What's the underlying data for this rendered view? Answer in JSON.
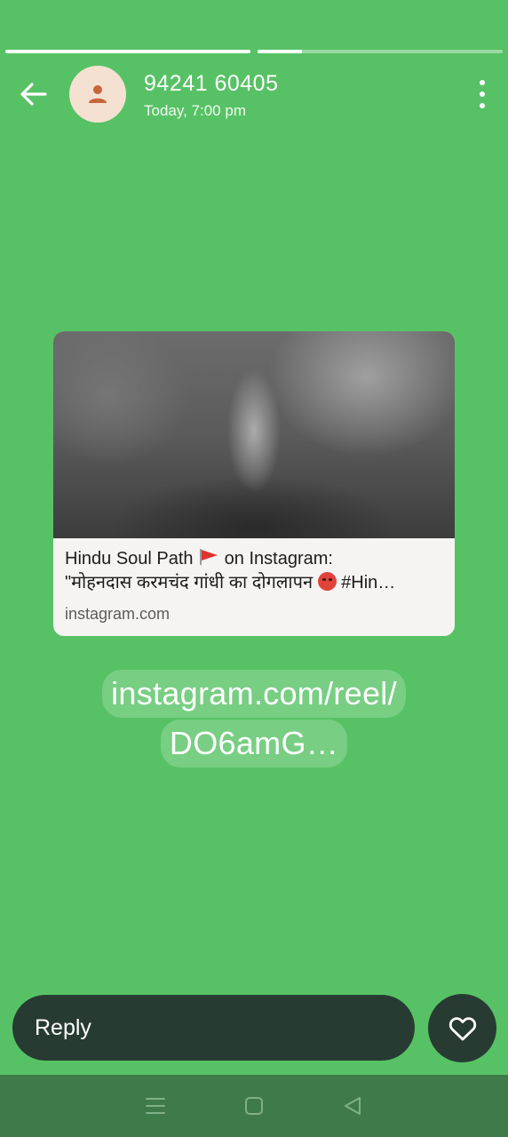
{
  "status": {
    "progress": [
      1.0,
      0.18
    ]
  },
  "header": {
    "contact_name": "94241 60405",
    "timestamp": "Today, 7:00 pm",
    "back_icon": "arrow-left-icon",
    "avatar_icon": "person-icon",
    "menu_icon": "more-vertical-icon"
  },
  "preview": {
    "title_line1_a": "Hindu Soul Path",
    "title_line1_b": "on Instagram:",
    "title_line2_a": "\"मोहनदास करमचंद गांधी का दोगलापन",
    "title_line2_b": "#Hin…",
    "domain": "instagram.com",
    "flag_icon": "red-flag-icon",
    "emoji_icon": "angry-face-icon"
  },
  "message": {
    "link_line1": "instagram.com/reel/",
    "link_line2": "DO6amG…"
  },
  "reply": {
    "placeholder": "Reply",
    "like_icon": "heart-icon"
  },
  "navbar": {
    "recents_icon": "menu-lines-icon",
    "home_icon": "square-icon",
    "back_icon": "triangle-back-icon"
  },
  "colors": {
    "background": "#57c265",
    "reply_bar": "#273b33",
    "navbar": "#3f7b4a",
    "card": "#f5f4f2"
  }
}
